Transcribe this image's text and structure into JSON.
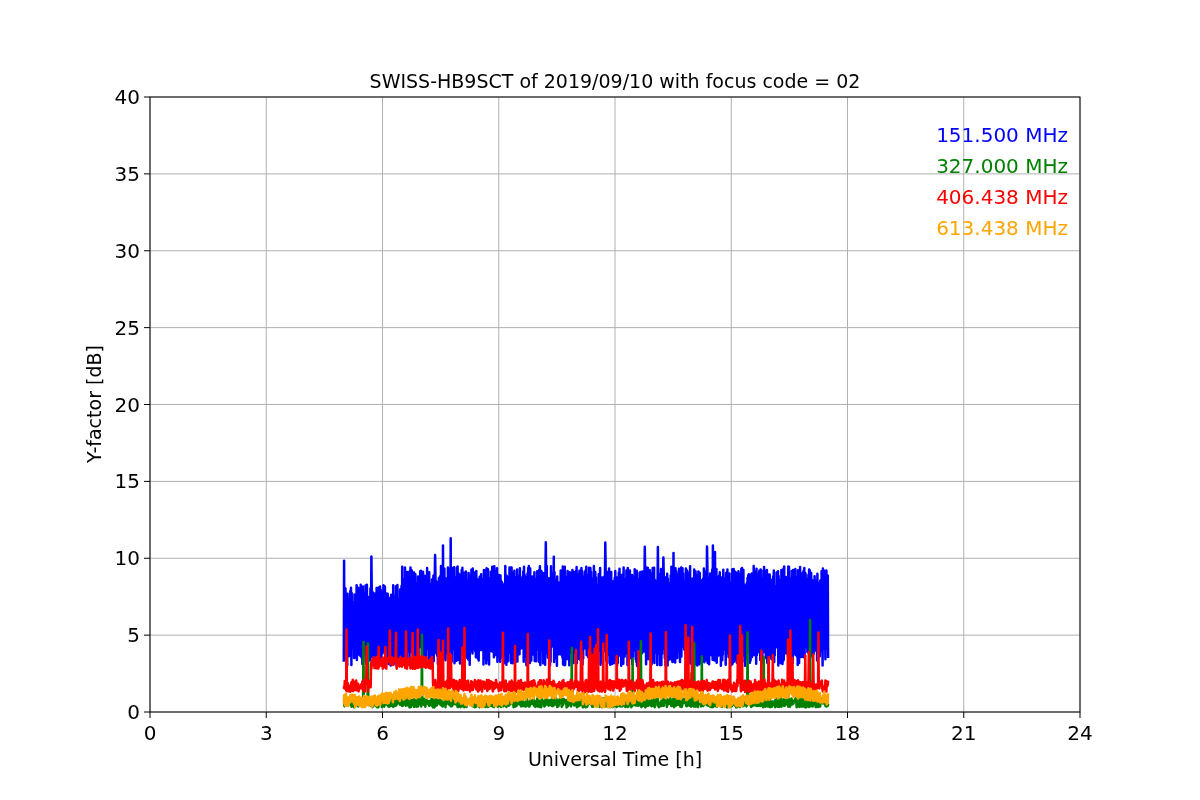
{
  "plot": {
    "title": "SWISS-HB9SCT of 2019/09/10 with focus code = 02",
    "xlabel": "Universal Time [h]",
    "ylabel": "Y-factor [dB]",
    "xticks": [
      "0",
      "3",
      "6",
      "9",
      "12",
      "15",
      "18",
      "21",
      "24"
    ],
    "yticks": [
      "40",
      "35",
      "30",
      "25",
      "20",
      "15",
      "10",
      "5",
      "0"
    ],
    "legend": [
      {
        "label": "151.500 MHz",
        "color": "#0000ff"
      },
      {
        "label": "327.000 MHz",
        "color": "#008000"
      },
      {
        "label": "406.438 MHz",
        "color": "#ff0000"
      },
      {
        "label": "613.438 MHz",
        "color": "#ffa500"
      }
    ]
  }
}
